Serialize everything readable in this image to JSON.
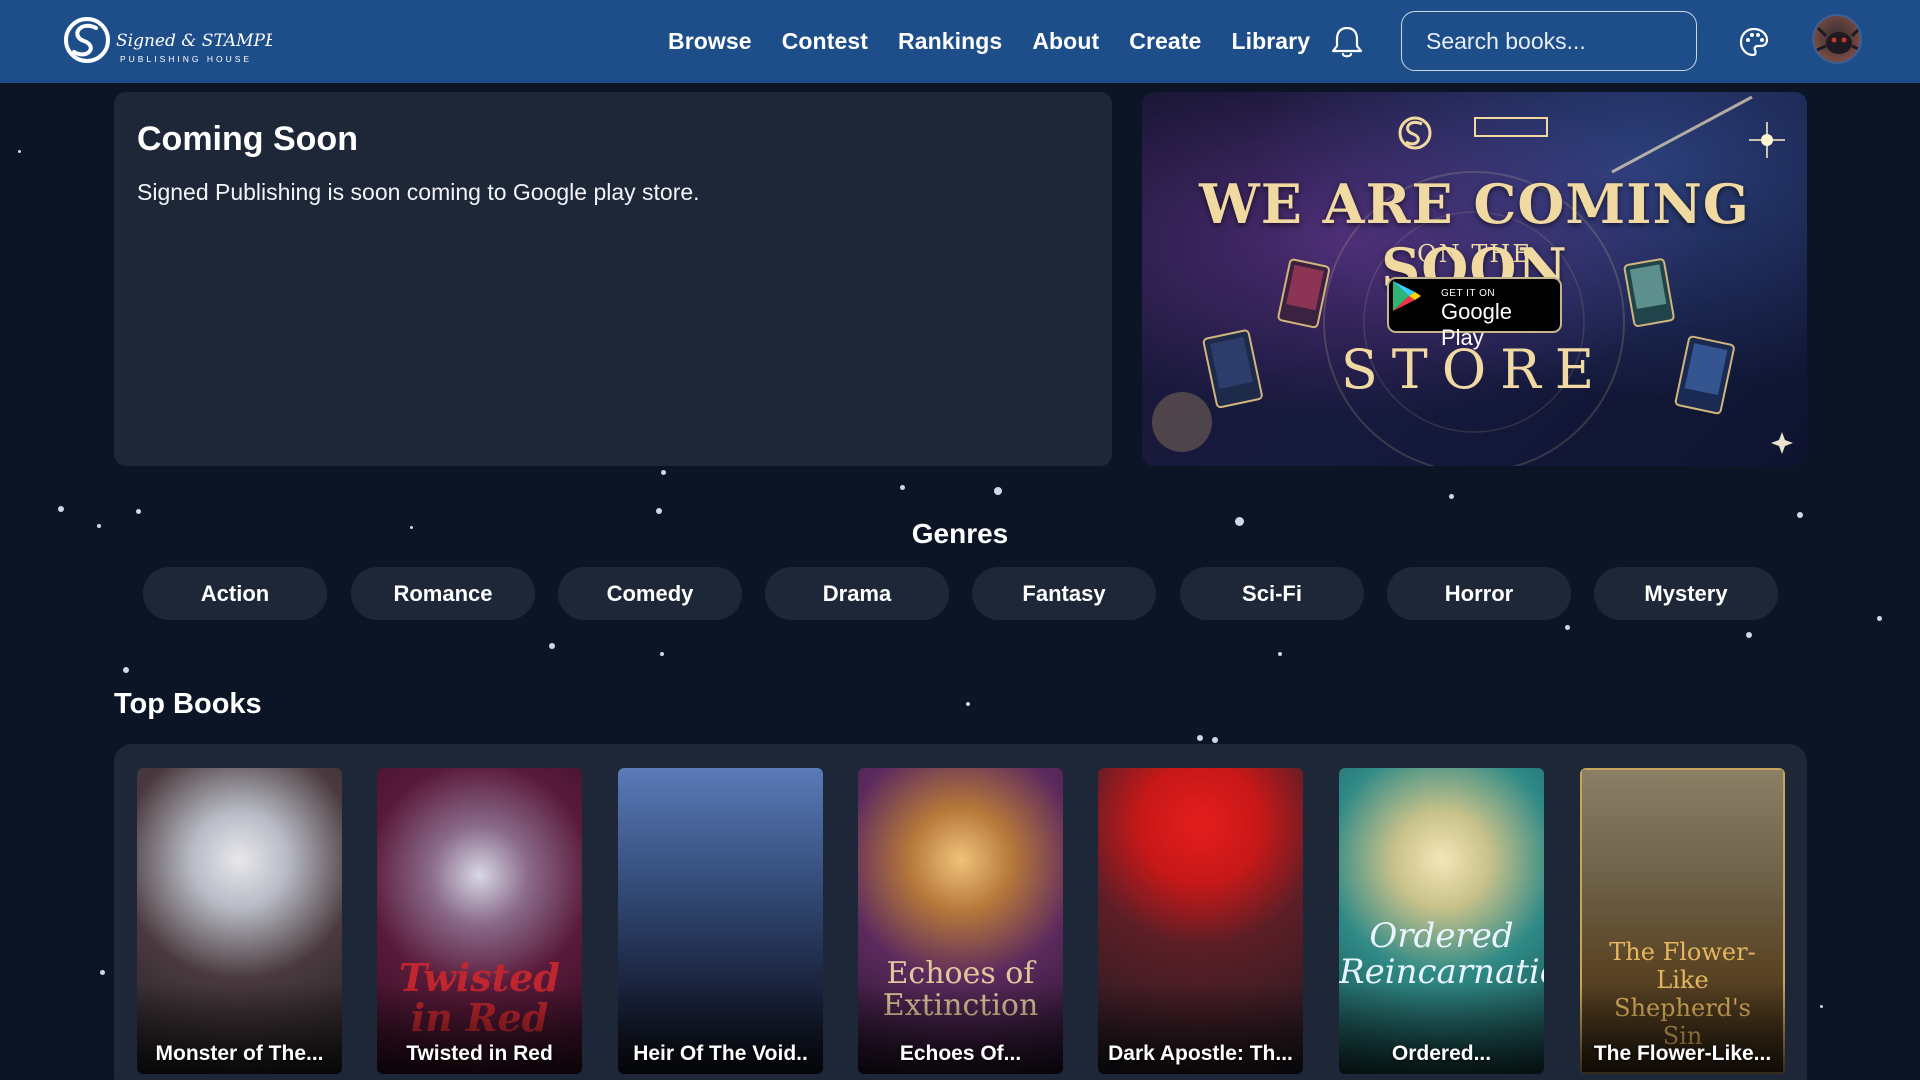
{
  "header": {
    "nav": [
      "Browse",
      "Contest",
      "Rankings",
      "About",
      "Create",
      "Library"
    ],
    "search_placeholder": "Search books...",
    "logo": {
      "brand": "Signed & STAMPED",
      "tagline": "PUBLISHING HOUSE"
    },
    "icons": [
      "bell-icon",
      "palette-icon",
      "avatar"
    ]
  },
  "announcement": {
    "title": "Coming Soon",
    "text": "Signed Publishing is soon coming to Google play store."
  },
  "banner": {
    "headline": "WE ARE COMING SOON",
    "subline": "ON THE",
    "store_word": "STORE",
    "badge_small": "GET IT ON",
    "badge_big": "Google Play"
  },
  "genres": {
    "title": "Genres",
    "items": [
      "Action",
      "Romance",
      "Comedy",
      "Drama",
      "Fantasy",
      "Sci-Fi",
      "Horror",
      "Mystery"
    ]
  },
  "top_books": {
    "title": "Top Books",
    "items": [
      {
        "title": "Monster of The...",
        "cover_text": ""
      },
      {
        "title": "Twisted in Red",
        "cover_text": "Twisted in Red"
      },
      {
        "title": "Heir Of The Void..",
        "cover_text": ""
      },
      {
        "title": "Echoes Of...",
        "cover_text": "Echoes of Extinction"
      },
      {
        "title": "Dark Apostle: Th...",
        "cover_text": ""
      },
      {
        "title": "Ordered...",
        "cover_text": "Ordered Reincarnation"
      },
      {
        "title": "The Flower-Like...",
        "cover_text": "The Flower-Like Shepherd's Sin"
      }
    ]
  },
  "colors": {
    "nav_bg": "#1d4e8a",
    "page_bg": "#0c1526",
    "card_bg": "#1e2738",
    "banner_gold": "#f1d9a2"
  }
}
